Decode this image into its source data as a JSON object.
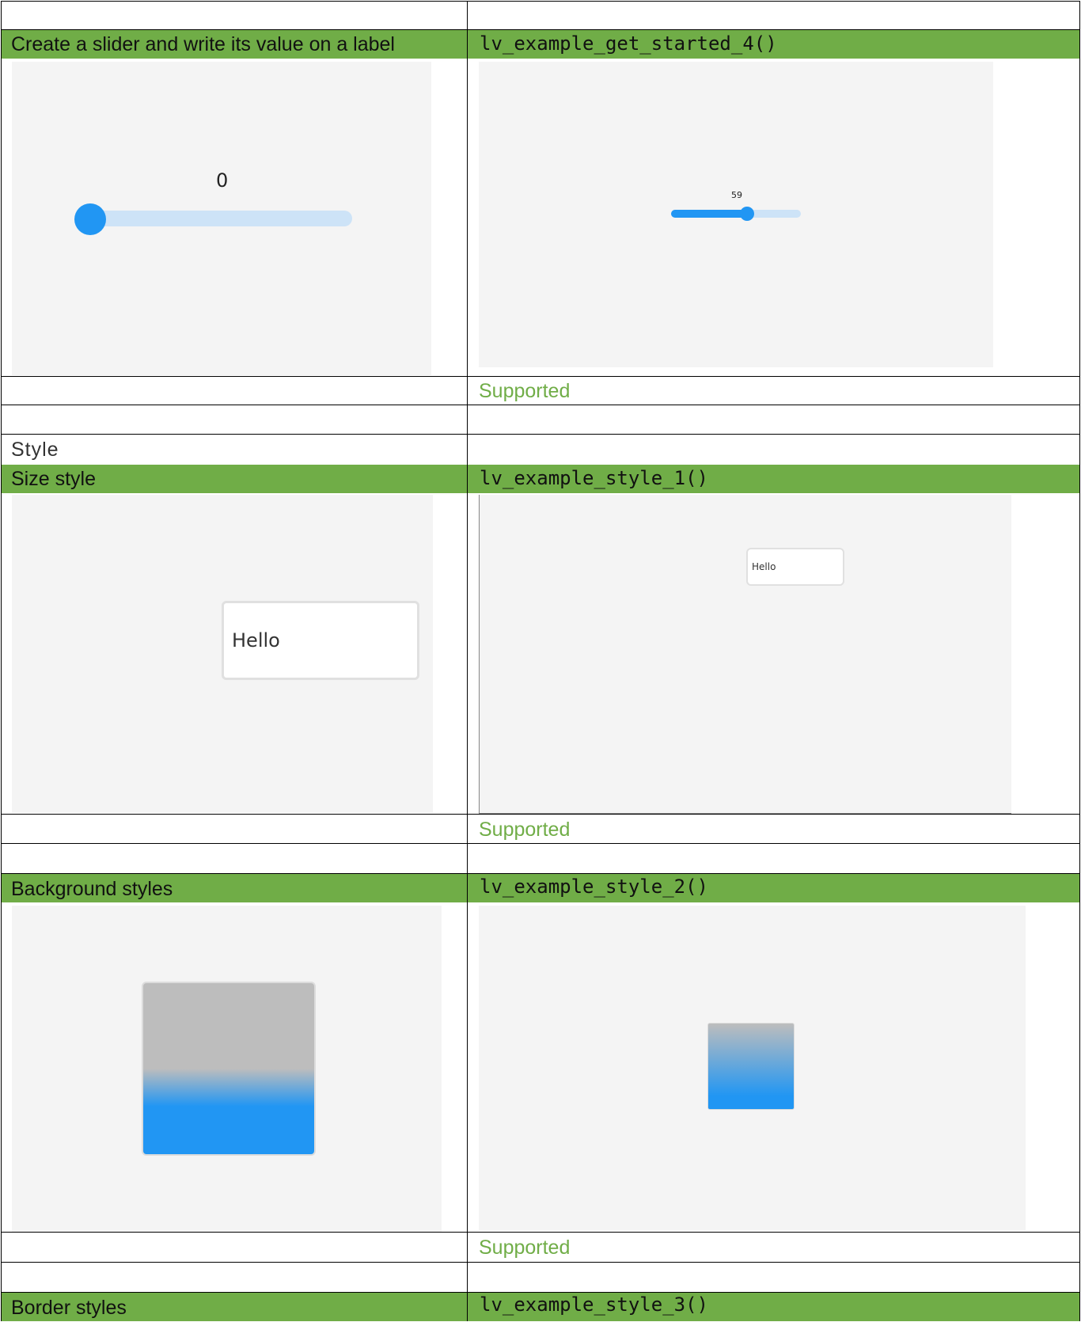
{
  "sections": {
    "style_heading": "Style"
  },
  "rows": [
    {
      "description": "Create a slider and write its value on a label",
      "function": "lv_example_get_started_4()",
      "status": "Supported",
      "reference_slider_value": "0",
      "port_slider_value": "59"
    },
    {
      "description": "Size style",
      "function": "lv_example_style_1()",
      "status": "Supported",
      "reference_label": "Hello",
      "port_label": "Hello"
    },
    {
      "description": "Background styles",
      "function": "lv_example_style_2()",
      "status": "Supported"
    },
    {
      "description": "Border styles",
      "function": "lv_example_style_3()"
    }
  ],
  "colors": {
    "header_band": "#70ad47",
    "supported_text": "#70ad47",
    "slider_blue": "#2196f3",
    "slider_track": "#cde3f7",
    "preview_bg": "#f4f4f4",
    "gradient_top": "#bdbdbd",
    "gradient_bottom": "#2196f3"
  }
}
